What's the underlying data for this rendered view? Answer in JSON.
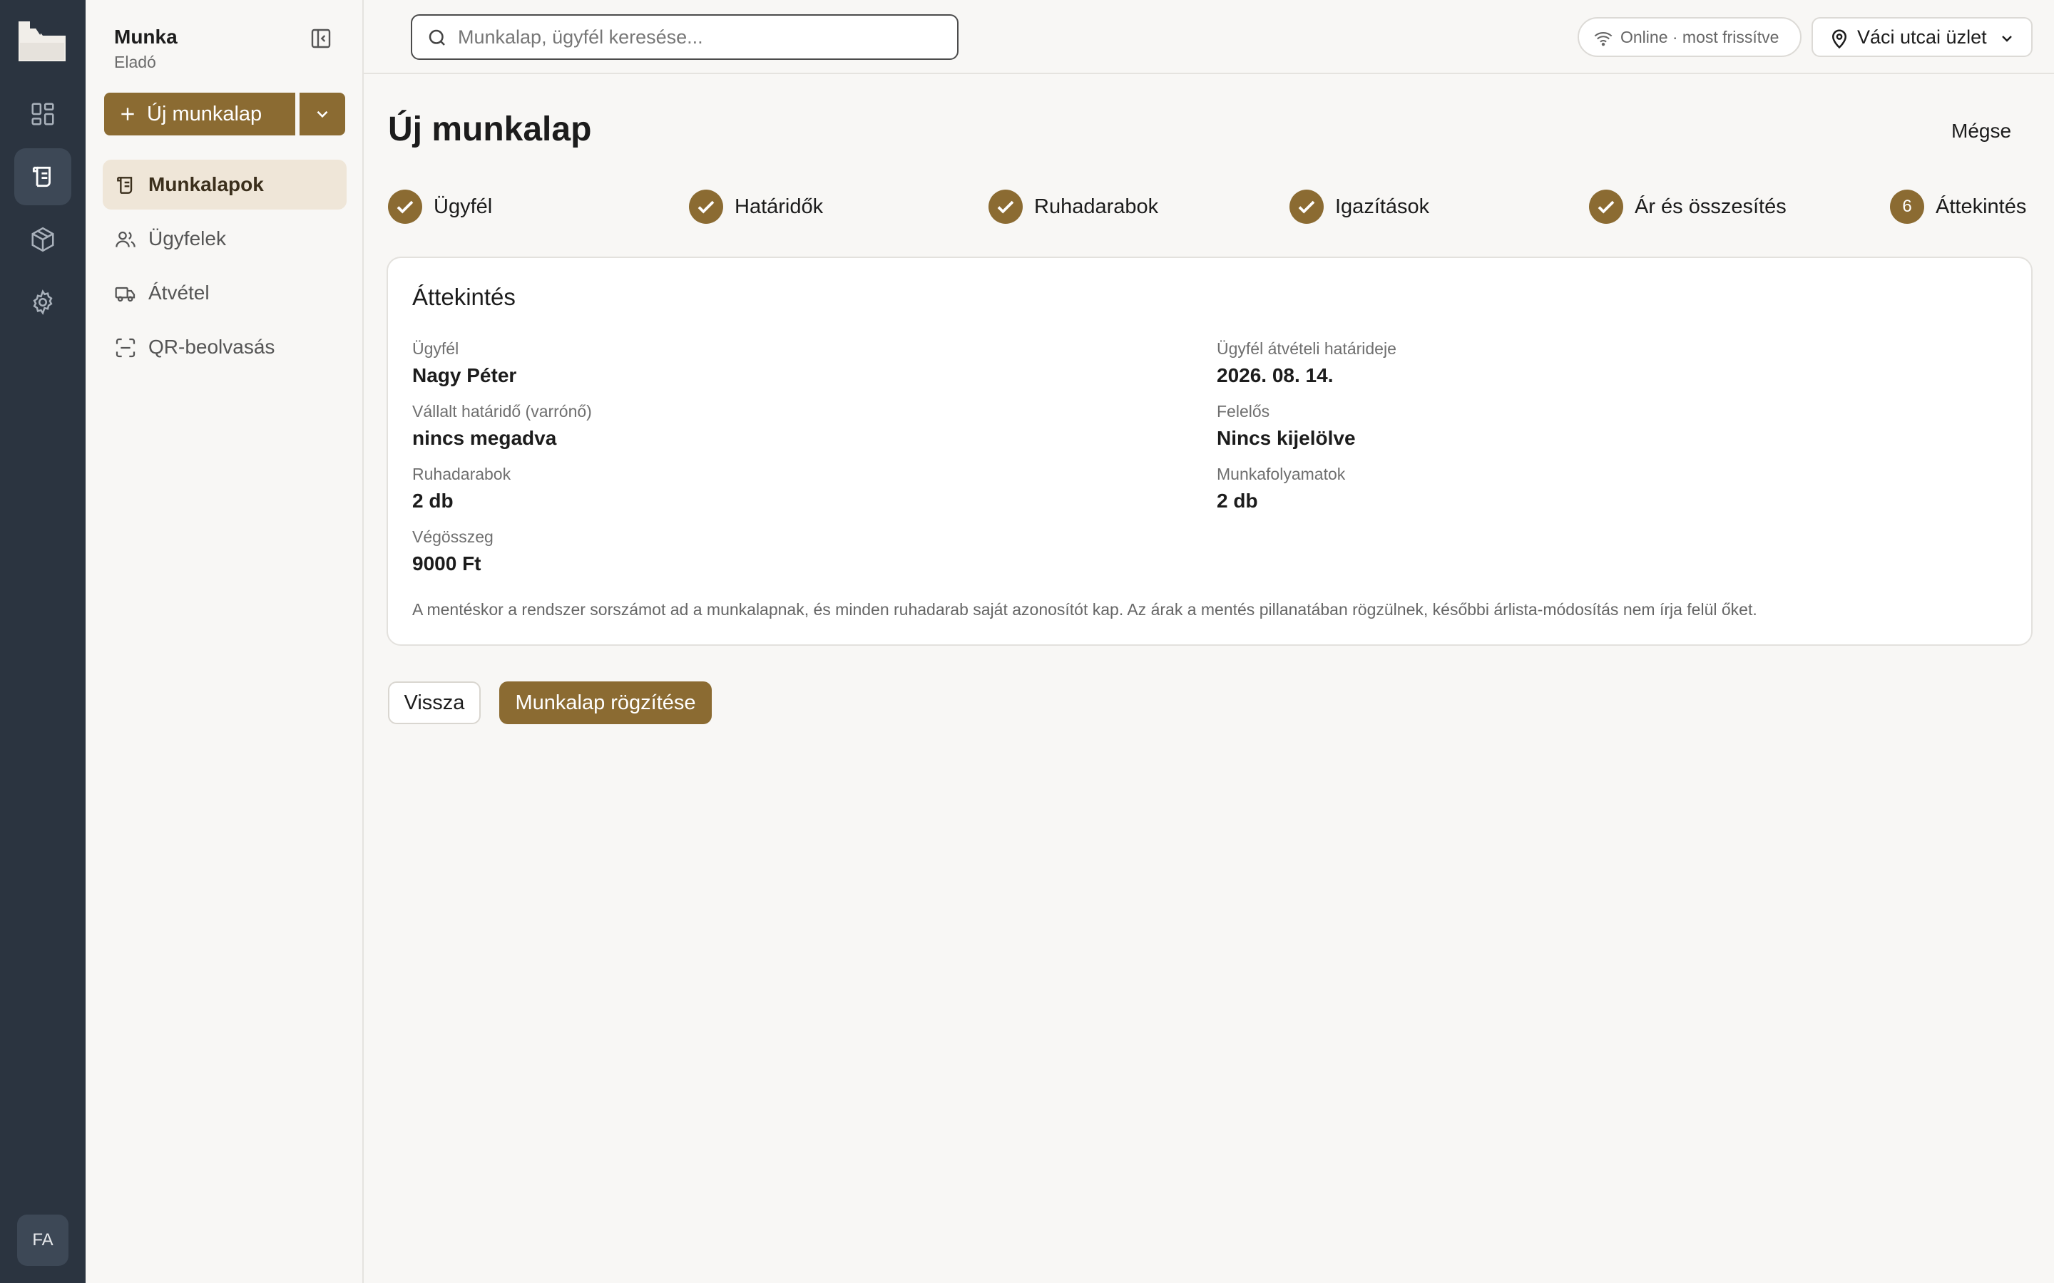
{
  "colors": {
    "accent": "#8b6b32",
    "rail_bg": "#2b3440",
    "active_nav_bg": "#efe6d8"
  },
  "rail": {
    "items": [
      {
        "icon": "dashboard-icon"
      },
      {
        "icon": "worksheet-icon",
        "active": true
      },
      {
        "icon": "package-icon"
      },
      {
        "icon": "settings-icon"
      }
    ],
    "avatar": "FA"
  },
  "sidebar": {
    "title": "Munka",
    "role": "Eladó",
    "new_button": "Új munkalap",
    "items": [
      {
        "label": "Munkalapok",
        "icon": "worksheet-icon",
        "active": true
      },
      {
        "label": "Ügyfelek",
        "icon": "users-icon"
      },
      {
        "label": "Átvétel",
        "icon": "truck-icon"
      },
      {
        "label": "QR-beolvasás",
        "icon": "scan-icon"
      }
    ]
  },
  "topbar": {
    "search_placeholder": "Munkalap, ügyfél keresése...",
    "status": "Online · most frissítve",
    "store": "Váci utcai üzlet"
  },
  "main": {
    "title": "Új munkalap",
    "cancel": "Mégse",
    "steps": [
      {
        "label": "Ügyfél",
        "done": true
      },
      {
        "label": "Határidők",
        "done": true
      },
      {
        "label": "Ruhadarabok",
        "done": true
      },
      {
        "label": "Igazítások",
        "done": true
      },
      {
        "label": "Ár és összesítés",
        "done": true
      },
      {
        "label": "Áttekintés",
        "number": "6",
        "done": false
      }
    ],
    "card": {
      "title": "Áttekintés",
      "fields": [
        {
          "label": "Ügyfél",
          "value": "Nagy Péter"
        },
        {
          "label": "Ügyfél átvételi határideje",
          "value": "2026. 08. 14."
        },
        {
          "label": "Vállalt határidő (varrónő)",
          "value": "nincs megadva"
        },
        {
          "label": "Felelős",
          "value": "Nincs kijelölve"
        },
        {
          "label": "Ruhadarabok",
          "value": "2 db"
        },
        {
          "label": "Munkafolyamatok",
          "value": "2 db"
        },
        {
          "label": "Végösszeg",
          "value": "9000 Ft"
        }
      ],
      "note": "A mentéskor a rendszer sorszámot ad a munkalapnak, és minden ruhadarab saját azonosítót kap. Az árak a mentés pillanatában rögzülnek, későbbi árlista-módosítás nem írja felül őket."
    },
    "back_button": "Vissza",
    "save_button": "Munkalap rögzítése"
  }
}
